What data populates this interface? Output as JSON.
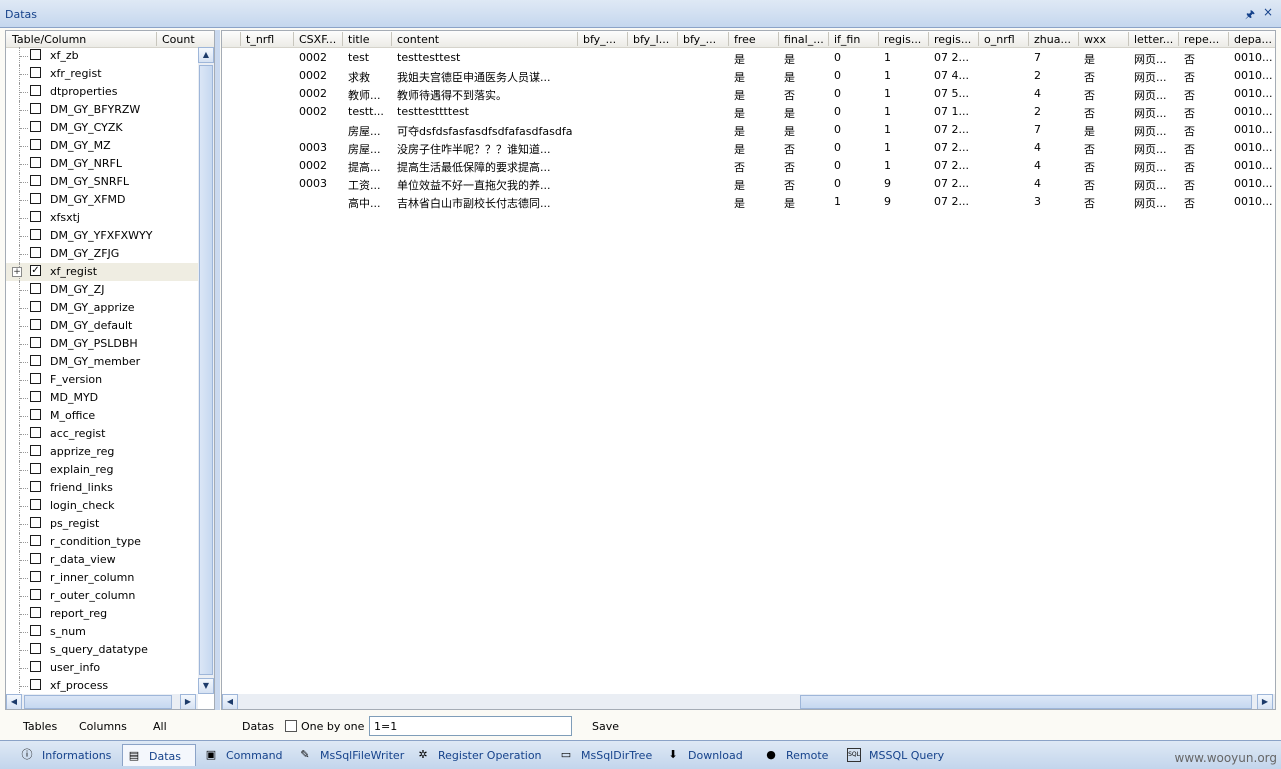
{
  "window": {
    "title": "Datas",
    "pin_glyph": "🖈",
    "close_glyph": "×"
  },
  "left_panel": {
    "col_table": "Table/Column",
    "col_count": "Count",
    "items": [
      {
        "label": "xf_zb",
        "checked": false
      },
      {
        "label": "xfr_regist",
        "checked": false
      },
      {
        "label": "dtproperties",
        "checked": false
      },
      {
        "label": "DM_GY_BFYRZW",
        "checked": false
      },
      {
        "label": "DM_GY_CYZK",
        "checked": false
      },
      {
        "label": "DM_GY_MZ",
        "checked": false
      },
      {
        "label": "DM_GY_NRFL",
        "checked": false
      },
      {
        "label": "DM_GY_SNRFL",
        "checked": false
      },
      {
        "label": "DM_GY_XFMD",
        "checked": false
      },
      {
        "label": "xfsxtj",
        "checked": false
      },
      {
        "label": "DM_GY_YFXFXWYY",
        "checked": false
      },
      {
        "label": "DM_GY_ZFJG",
        "checked": false
      },
      {
        "label": "xf_regist",
        "checked": true,
        "expandable": true,
        "selected": true
      },
      {
        "label": "DM_GY_ZJ",
        "checked": false
      },
      {
        "label": "DM_GY_apprize",
        "checked": false
      },
      {
        "label": "DM_GY_default",
        "checked": false
      },
      {
        "label": "DM_GY_PSLDBH",
        "checked": false
      },
      {
        "label": "DM_GY_member",
        "checked": false
      },
      {
        "label": "F_version",
        "checked": false
      },
      {
        "label": "MD_MYD",
        "checked": false
      },
      {
        "label": "M_office",
        "checked": false
      },
      {
        "label": "acc_regist",
        "checked": false
      },
      {
        "label": "apprize_reg",
        "checked": false
      },
      {
        "label": "explain_reg",
        "checked": false
      },
      {
        "label": "friend_links",
        "checked": false
      },
      {
        "label": "login_check",
        "checked": false
      },
      {
        "label": "ps_regist",
        "checked": false
      },
      {
        "label": "r_condition_type",
        "checked": false
      },
      {
        "label": "r_data_view",
        "checked": false
      },
      {
        "label": "r_inner_column",
        "checked": false
      },
      {
        "label": "r_outer_column",
        "checked": false
      },
      {
        "label": "report_reg",
        "checked": false
      },
      {
        "label": "s_num",
        "checked": false
      },
      {
        "label": "s_query_datatype",
        "checked": false
      },
      {
        "label": "user_info",
        "checked": false
      },
      {
        "label": "xf_process",
        "checked": false
      }
    ],
    "buttons": {
      "tables": "Tables",
      "columns": "Columns",
      "all": "All"
    },
    "check_mark": "✓",
    "expander_glyph": "+"
  },
  "grid": {
    "columns": [
      "t_nrfl",
      "CSXF...",
      "title",
      "content",
      "bfy_...",
      "bfy_l...",
      "bfy_...",
      "free",
      "final_...",
      "if_fin",
      "regis...",
      "regis...",
      "o_nrfl",
      "zhua...",
      "wxx",
      "letter...",
      "repe...",
      "depa..."
    ],
    "rows": [
      [
        "",
        "0002",
        "test",
        "testtesttest",
        "",
        "",
        "",
        "是",
        "是",
        "0",
        "1",
        "07 2...",
        "",
        "7",
        "是",
        "网页...",
        "否",
        "0010..."
      ],
      [
        "",
        "0002",
        "求救",
        "我姐夫宫德臣申通医务人员谋...",
        "",
        "",
        "",
        "是",
        "是",
        "0",
        "1",
        "07 4...",
        "",
        "2",
        "否",
        "网页...",
        "否",
        "0010..."
      ],
      [
        "",
        "0002",
        "教师...",
        "教师待遇得不到落实。",
        "",
        "",
        "",
        "是",
        "否",
        "0",
        "1",
        "07 5...",
        "",
        "4",
        "否",
        "网页...",
        "否",
        "0010..."
      ],
      [
        "",
        "0002",
        "testt...",
        "testtesttttest",
        "",
        "",
        "",
        "是",
        "是",
        "0",
        "1",
        "07 1...",
        "",
        "2",
        "否",
        "网页...",
        "否",
        "0010..."
      ],
      [
        "",
        "",
        "房屋...",
        "可夺dsfdsfasfasdfsdfafasdfasdfa",
        "",
        "",
        "",
        "是",
        "是",
        "0",
        "1",
        "07 2...",
        "",
        "7",
        "是",
        "网页...",
        "否",
        "0010..."
      ],
      [
        "",
        "0003",
        "房屋...",
        "没房子住咋半呢？？？谁知道...",
        "",
        "",
        "",
        "是",
        "否",
        "0",
        "1",
        "07 2...",
        "",
        "4",
        "否",
        "网页...",
        "否",
        "0010..."
      ],
      [
        "",
        "0002",
        "提高...",
        "提高生活最低保障的要求提高...",
        "",
        "",
        "",
        "否",
        "否",
        "0",
        "1",
        "07 2...",
        "",
        "4",
        "否",
        "网页...",
        "否",
        "0010..."
      ],
      [
        "",
        "0003",
        "工资...",
        "单位效益不好一直拖欠我的养...",
        "",
        "",
        "",
        "是",
        "否",
        "0",
        "9",
        "07 2...",
        "",
        "4",
        "否",
        "网页...",
        "否",
        "0010..."
      ],
      [
        "",
        "",
        "高中...",
        "吉林省白山市副校长付志德同...",
        "",
        "",
        "",
        "是",
        "是",
        "1",
        "9",
        "07 2...",
        "",
        "3",
        "否",
        "网页...",
        "否",
        "0010..."
      ]
    ]
  },
  "query_bar": {
    "datas": "Datas",
    "one_by_one": "One by one",
    "where_value": "1=1",
    "save": "Save"
  },
  "tabs": [
    {
      "label": "Informations",
      "icon": "info-icon",
      "glyph": "ⓘ",
      "active": false
    },
    {
      "label": "Datas",
      "icon": "database-icon",
      "glyph": "▤",
      "active": true
    },
    {
      "label": "Command",
      "icon": "terminal-icon",
      "glyph": "▣",
      "active": false
    },
    {
      "label": "MsSqlFileWriter",
      "icon": "file-writer-icon",
      "glyph": "✎",
      "active": false
    },
    {
      "label": "Register Operation",
      "icon": "register-icon",
      "glyph": "✲",
      "active": false
    },
    {
      "label": "MsSqlDirTree",
      "icon": "folder-icon",
      "glyph": "▭",
      "active": false
    },
    {
      "label": "Download",
      "icon": "download-icon",
      "glyph": "⬇",
      "active": false
    },
    {
      "label": "Remote",
      "icon": "globe-icon",
      "glyph": "●",
      "active": false
    },
    {
      "label": "MSSQL Query",
      "icon": "sql-icon",
      "glyph": "SQL",
      "active": false
    }
  ],
  "watermark": "www.wooyun.org"
}
